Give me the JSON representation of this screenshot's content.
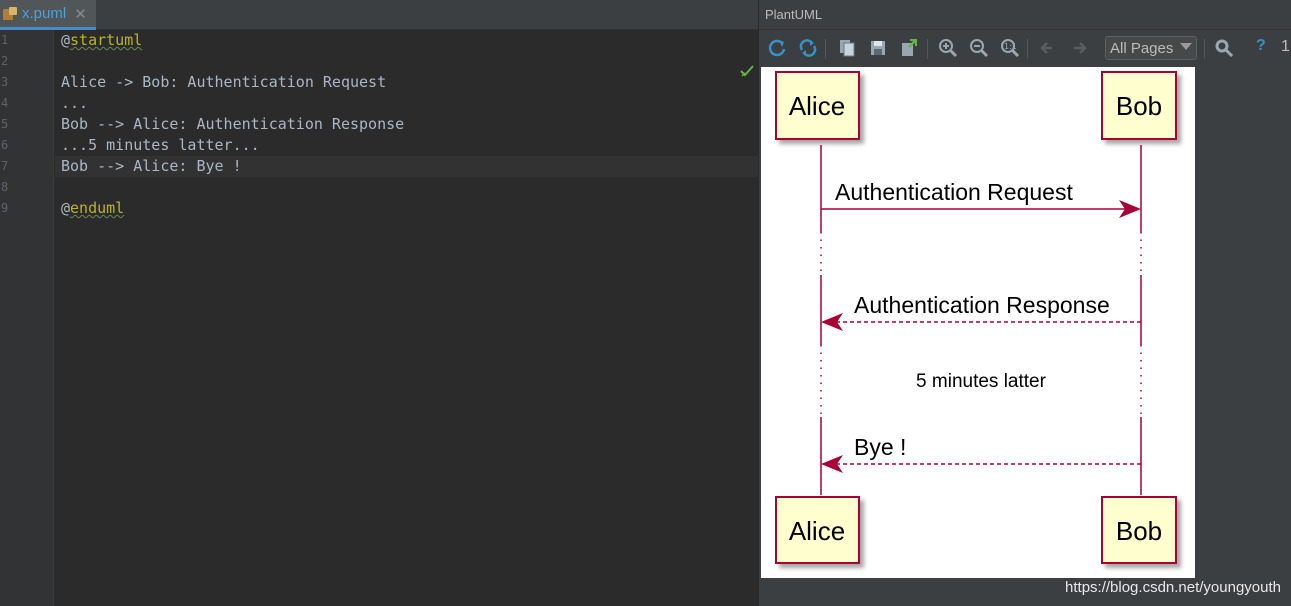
{
  "editor": {
    "tab": {
      "title": "x.puml",
      "close_glyph": "✕",
      "icon": "puml-file-icon"
    },
    "line_numbers": [
      "1",
      "2",
      "3",
      "4",
      "5",
      "6",
      "7",
      "8",
      "9"
    ],
    "lines": [
      {
        "at": "@",
        "word": "startuml"
      },
      {
        "text": ""
      },
      {
        "text": "Alice -> Bob: Authentication Request"
      },
      {
        "text": "..."
      },
      {
        "text": "Bob --> Alice: Authentication Response"
      },
      {
        "text": "...5 minutes latter..."
      },
      {
        "text": "Bob --> Alice: Bye !"
      },
      {
        "text": ""
      },
      {
        "at": "@",
        "word": "enduml"
      }
    ],
    "status_icon": "checkmark-icon"
  },
  "panel": {
    "title": "PlantUML",
    "toolbar": {
      "buttons": [
        "refresh-icon",
        "sync-icon",
        "copy-icon",
        "save-icon",
        "export-icon",
        "zoom-in-icon",
        "zoom-out-icon",
        "zoom-actual-icon",
        "prev-page-icon",
        "next-page-icon"
      ],
      "page_select": "All Pages",
      "settings_icon": "settings-icon",
      "help_label": "?",
      "extra_label": "1"
    },
    "diagram": {
      "participants": [
        "Alice",
        "Bob"
      ],
      "messages": [
        {
          "from": "Alice",
          "to": "Bob",
          "label": "Authentication Request",
          "style": "solid"
        },
        {
          "from": "Bob",
          "to": "Alice",
          "label": "Authentication Response",
          "style": "dashed"
        },
        {
          "from": "Bob",
          "to": "Alice",
          "label": "Bye !",
          "style": "dashed"
        }
      ],
      "delay_label": "5 minutes latter",
      "colors": {
        "participant_fill": "#fefece",
        "participant_border": "#a80036",
        "lifeline": "#a80036",
        "arrow": "#a80036"
      }
    }
  },
  "watermark": "https://blog.csdn.net/youngyouth",
  "colors": {
    "editor_bg": "#2b2b2b",
    "panel_bg": "#3c3f41",
    "keyword": "#bbb529",
    "code_text": "#a9b7c6",
    "tab_accent": "#4a88c7"
  }
}
